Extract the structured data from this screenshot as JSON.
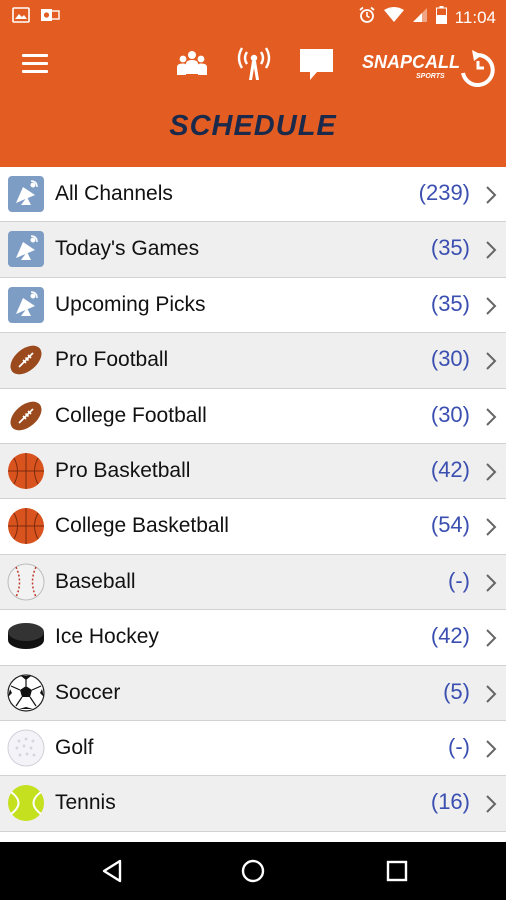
{
  "status_bar": {
    "time": "11:04"
  },
  "app_bar": {
    "title": "SCHEDULE",
    "logo_text": "SNAPCALL",
    "logo_sub": "SPORTS",
    "color": "#e35d22",
    "icons": [
      "menu-icon",
      "group-icon",
      "broadcast-icon",
      "chat-icon"
    ]
  },
  "categories": [
    {
      "label": "All Channels",
      "count": "(239)",
      "icon": "channel-icon"
    },
    {
      "label": "Today's Games",
      "count": "(35)",
      "icon": "channel-icon"
    },
    {
      "label": "Upcoming Picks",
      "count": "(35)",
      "icon": "channel-icon"
    },
    {
      "label": "Pro Football",
      "count": "(30)",
      "icon": "football-icon"
    },
    {
      "label": "College Football",
      "count": "(30)",
      "icon": "football-icon"
    },
    {
      "label": "Pro Basketball",
      "count": "(42)",
      "icon": "basketball-icon"
    },
    {
      "label": "College Basketball",
      "count": "(54)",
      "icon": "basketball-icon"
    },
    {
      "label": "Baseball",
      "count": "(-)",
      "icon": "baseball-icon"
    },
    {
      "label": "Ice Hockey",
      "count": "(42)",
      "icon": "hockey-puck-icon"
    },
    {
      "label": "Soccer",
      "count": "(5)",
      "icon": "soccer-ball-icon"
    },
    {
      "label": "Golf",
      "count": "(-)",
      "icon": "golf-ball-icon"
    },
    {
      "label": "Tennis",
      "count": "(16)",
      "icon": "tennis-ball-icon"
    }
  ],
  "nav_bar": {
    "icons": [
      "back-icon",
      "home-icon",
      "recents-icon"
    ]
  }
}
